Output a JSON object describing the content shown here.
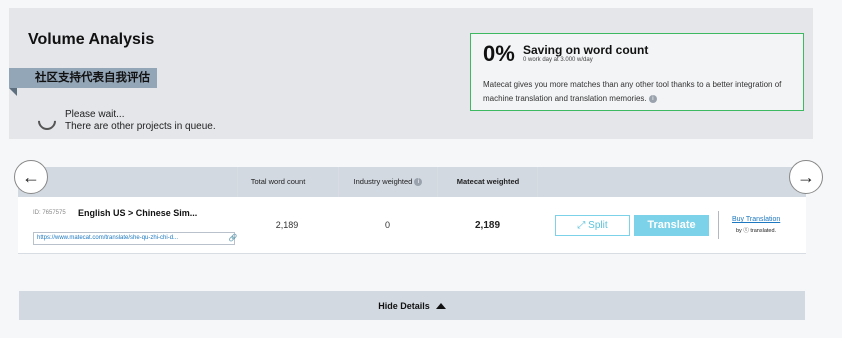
{
  "analysis": {
    "title": "Volume Analysis",
    "project_name": "社区支持代表自我评估",
    "wait_line1": "Please wait...",
    "wait_line2": "There are other projects in queue."
  },
  "saving": {
    "percent": "0%",
    "title": "Saving on word count",
    "subtitle": "0 work day at 3.000 w/day",
    "description": "Matecat gives you more matches than any other tool thanks to a better integration of machine translation and translation memories.",
    "info_icon": "i"
  },
  "nav": {
    "prev_icon": "←",
    "next_icon": "→"
  },
  "table": {
    "headers": {
      "total": "Total word count",
      "industry": "Industry weighted",
      "matecat": "Matecat weighted"
    },
    "rows": [
      {
        "id": "ID: 7657575",
        "languages": "English US >  Chinese Sim...",
        "url": "https://www.matecat.com/translate/she-qu-zhi-chi-d...",
        "total": "2,189",
        "industry": "0",
        "matecat": "2,189",
        "split_label": "Split",
        "translate_label": "Translate",
        "buy_label": "Buy Translation",
        "by_label": "by ⓣ translated."
      }
    ]
  },
  "footer": {
    "hide_details": "Hide Details"
  }
}
